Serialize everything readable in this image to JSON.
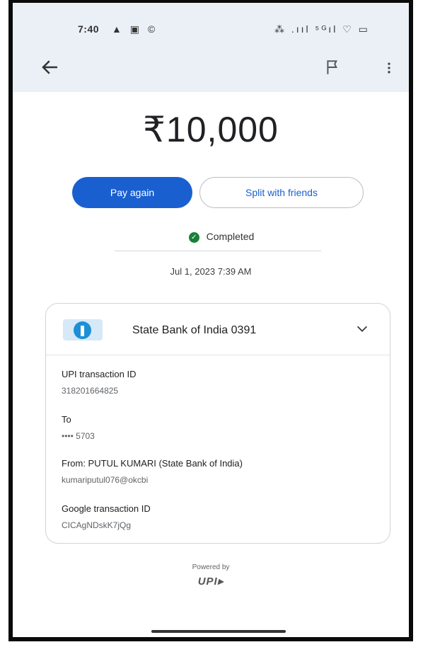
{
  "status_bar": {
    "time": "7:40",
    "left_icons": "▲ ▣ ©",
    "right_icons": "⁂ .ııl ⁵ᴳıl ♡ ▭"
  },
  "transaction": {
    "amount": "₹10,000",
    "pay_again_label": "Pay again",
    "split_label": "Split with friends",
    "status": "Completed",
    "datetime": "Jul 1, 2023 7:39 AM"
  },
  "bank_card": {
    "bank_name": "State Bank of India 0391",
    "details": [
      {
        "label": "UPI transaction ID",
        "value": "318201664825"
      },
      {
        "label": "To",
        "value": "•••• 5703"
      },
      {
        "label": "From: PUTUL  KUMARI (State Bank of India)",
        "value": "kumariputul076@okcbi"
      },
      {
        "label": "Google transaction ID",
        "value": "CICAgNDskK7jQg"
      }
    ]
  },
  "footer": {
    "powered_by": "Powered by",
    "upi_logo": "UPI▸"
  },
  "icons": {
    "back": "arrow-left-icon",
    "report": "flag-icon",
    "more": "more-vertical-icon",
    "status": "check-circle-icon",
    "expand": "chevron-down-icon"
  },
  "colors": {
    "accent": "#1a5fd0",
    "success": "#188038",
    "header_bg": "#eaf0f6"
  }
}
